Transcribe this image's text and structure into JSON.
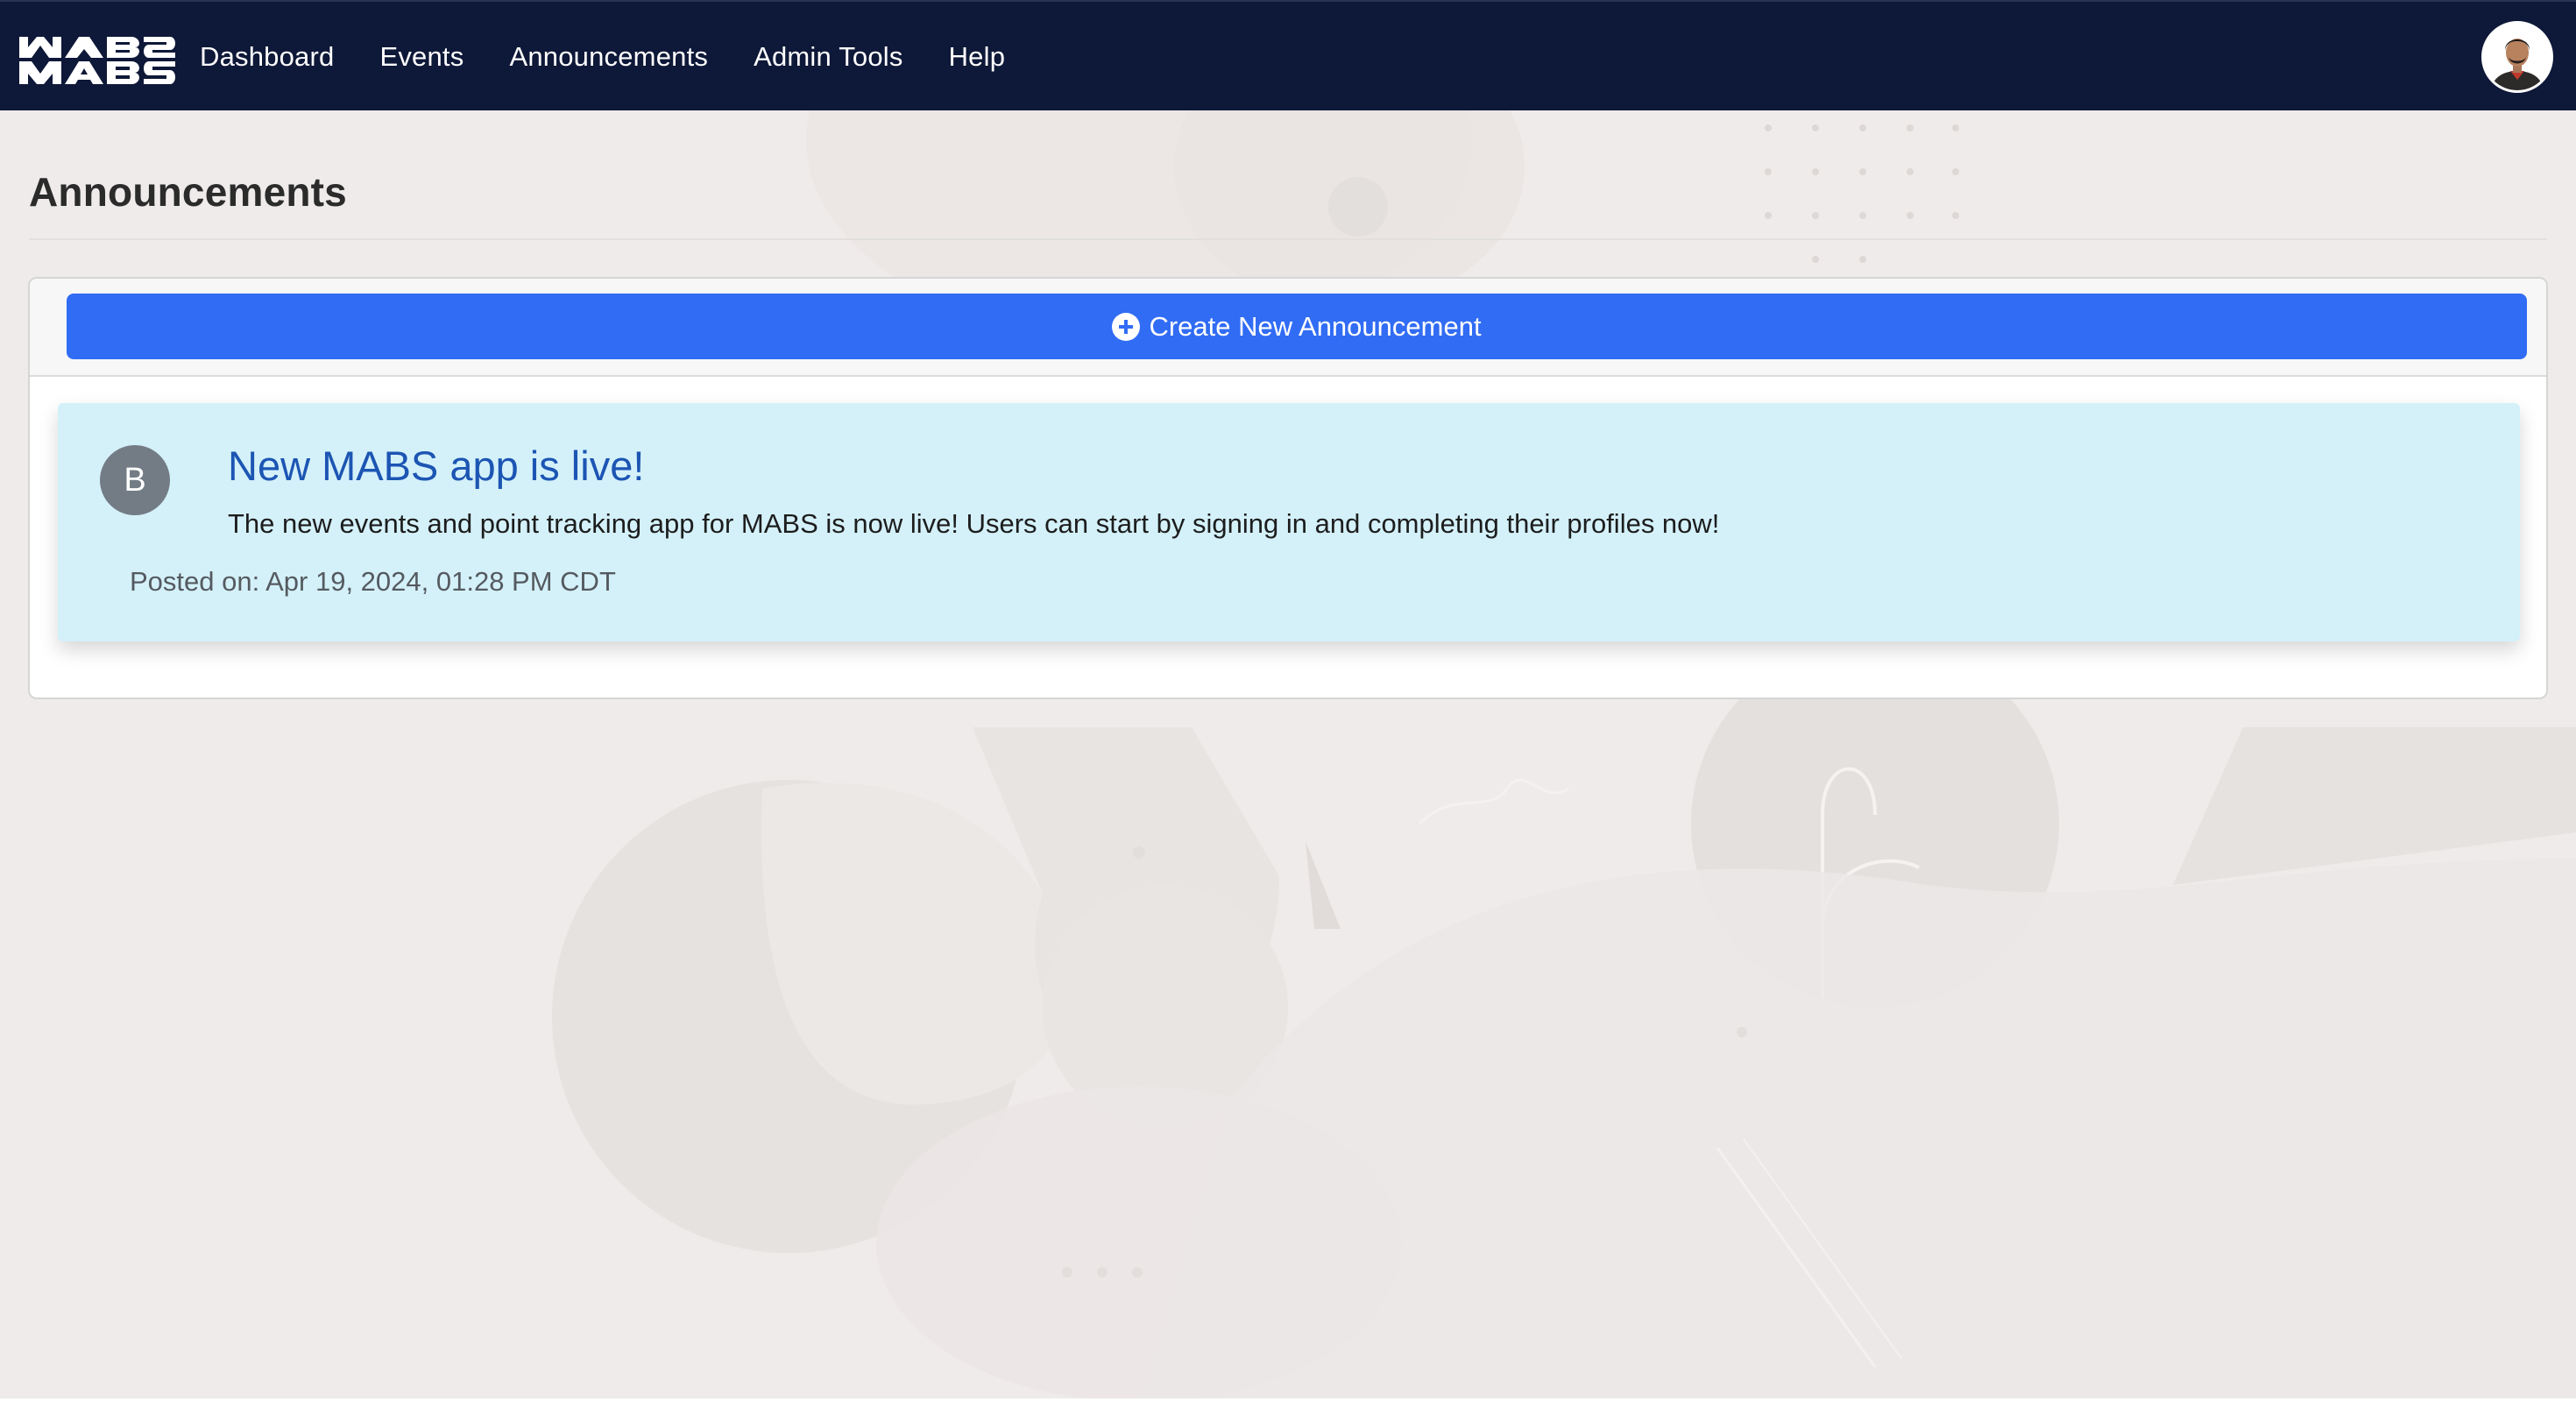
{
  "navbar": {
    "logo_alt": "MABS logo",
    "links": [
      {
        "label": "Dashboard"
      },
      {
        "label": "Events"
      },
      {
        "label": "Announcements"
      },
      {
        "label": "Admin Tools"
      },
      {
        "label": "Help"
      }
    ],
    "avatar_icon": "user-avatar"
  },
  "page": {
    "title": "Announcements"
  },
  "toolbar": {
    "create_label": "Create New Announcement",
    "create_icon": "plus-circle-icon",
    "create_color": "#316cf4"
  },
  "announcements": [
    {
      "author_initial": "B",
      "title": "New MABS app is live!",
      "body": "The new events and point tracking app for MABS is now live! Users can start by signing in and completing their profiles now!",
      "posted": "Posted on: Apr 19, 2024, 01:28 PM CDT"
    }
  ],
  "colors": {
    "navbar": "#0e1838",
    "announcement_bg": "#d4f1fa",
    "announcement_title": "#1c55b3",
    "author_avatar": "#737c85"
  }
}
